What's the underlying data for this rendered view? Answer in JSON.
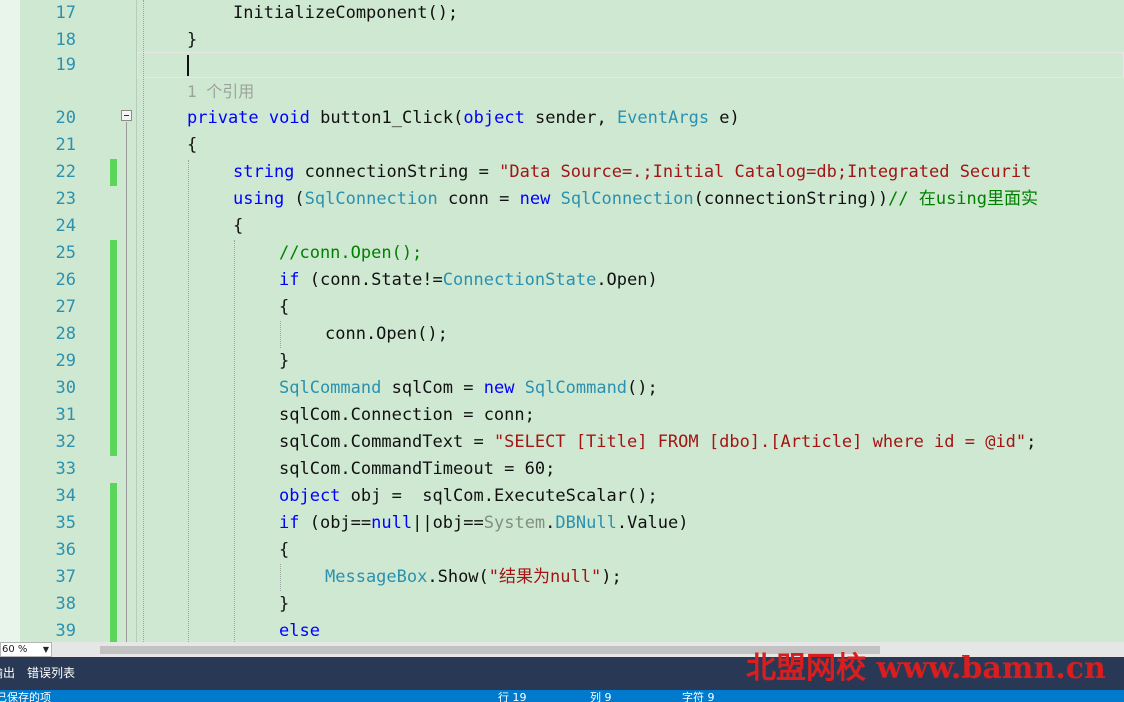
{
  "editor": {
    "codelens": "1 个引用",
    "lines": [
      {
        "num": "17",
        "indent": 1,
        "tokens": [
          {
            "t": "InitializeComponent();",
            "c": ""
          }
        ]
      },
      {
        "num": "18",
        "indent": 0,
        "tokens": [
          {
            "t": "}",
            "c": ""
          }
        ]
      },
      {
        "num": "19",
        "indent": 0,
        "tokens": []
      },
      {
        "num": "20",
        "indent": 0,
        "tokens": [
          {
            "t": "private",
            "c": "kw"
          },
          {
            "t": " ",
            "c": ""
          },
          {
            "t": "void",
            "c": "kw"
          },
          {
            "t": " button1_Click(",
            "c": ""
          },
          {
            "t": "object",
            "c": "kw"
          },
          {
            "t": " sender, ",
            "c": ""
          },
          {
            "t": "EventArgs",
            "c": "ty"
          },
          {
            "t": " e)",
            "c": ""
          }
        ]
      },
      {
        "num": "21",
        "indent": 0,
        "tokens": [
          {
            "t": "{",
            "c": ""
          }
        ]
      },
      {
        "num": "22",
        "indent": 1,
        "changed": true,
        "tokens": [
          {
            "t": "string",
            "c": "kw"
          },
          {
            "t": " connectionString = ",
            "c": ""
          },
          {
            "t": "\"Data Source=.;Initial Catalog=db;Integrated Securit",
            "c": "str"
          }
        ]
      },
      {
        "num": "23",
        "indent": 1,
        "tokens": [
          {
            "t": "using",
            "c": "kw"
          },
          {
            "t": " (",
            "c": ""
          },
          {
            "t": "SqlConnection",
            "c": "ty"
          },
          {
            "t": " conn = ",
            "c": ""
          },
          {
            "t": "new",
            "c": "kw"
          },
          {
            "t": " ",
            "c": ""
          },
          {
            "t": "SqlConnection",
            "c": "ty"
          },
          {
            "t": "(connectionString))",
            "c": ""
          },
          {
            "t": "// 在using里面实",
            "c": "cm"
          }
        ]
      },
      {
        "num": "24",
        "indent": 1,
        "tokens": [
          {
            "t": "{",
            "c": ""
          }
        ]
      },
      {
        "num": "25",
        "indent": 2,
        "changed": true,
        "tokens": [
          {
            "t": "//conn.Open();",
            "c": "cm"
          }
        ]
      },
      {
        "num": "26",
        "indent": 2,
        "changed": true,
        "tokens": [
          {
            "t": "if",
            "c": "kw"
          },
          {
            "t": " (conn.State!=",
            "c": ""
          },
          {
            "t": "ConnectionState",
            "c": "ty"
          },
          {
            "t": ".Open)",
            "c": ""
          }
        ]
      },
      {
        "num": "27",
        "indent": 2,
        "changed": true,
        "tokens": [
          {
            "t": "{",
            "c": ""
          }
        ]
      },
      {
        "num": "28",
        "indent": 3,
        "changed": true,
        "tokens": [
          {
            "t": "conn.Open();",
            "c": ""
          }
        ]
      },
      {
        "num": "29",
        "indent": 2,
        "changed": true,
        "tokens": [
          {
            "t": "}",
            "c": ""
          }
        ]
      },
      {
        "num": "30",
        "indent": 2,
        "changed": true,
        "tokens": [
          {
            "t": "SqlCommand",
            "c": "ty"
          },
          {
            "t": " sqlCom = ",
            "c": ""
          },
          {
            "t": "new",
            "c": "kw"
          },
          {
            "t": " ",
            "c": ""
          },
          {
            "t": "SqlCommand",
            "c": "ty"
          },
          {
            "t": "();",
            "c": ""
          }
        ]
      },
      {
        "num": "31",
        "indent": 2,
        "changed": true,
        "tokens": [
          {
            "t": "sqlCom.Connection = conn;",
            "c": ""
          }
        ]
      },
      {
        "num": "32",
        "indent": 2,
        "changed": true,
        "tokens": [
          {
            "t": "sqlCom.CommandText = ",
            "c": ""
          },
          {
            "t": "\"SELECT [Title] FROM [dbo].[Article] where id = @id\"",
            "c": "str"
          },
          {
            "t": ";",
            "c": ""
          }
        ]
      },
      {
        "num": "33",
        "indent": 2,
        "tokens": [
          {
            "t": "sqlCom.CommandTimeout = 60;",
            "c": ""
          }
        ]
      },
      {
        "num": "34",
        "indent": 2,
        "changed": true,
        "tokens": [
          {
            "t": "object",
            "c": "kw"
          },
          {
            "t": " obj =  sqlCom.ExecuteScalar();",
            "c": ""
          }
        ]
      },
      {
        "num": "35",
        "indent": 2,
        "changed": true,
        "tokens": [
          {
            "t": "if",
            "c": "kw"
          },
          {
            "t": " (obj==",
            "c": ""
          },
          {
            "t": "null",
            "c": "kw"
          },
          {
            "t": "||obj==",
            "c": ""
          },
          {
            "t": "System",
            "c": "gr"
          },
          {
            "t": ".",
            "c": ""
          },
          {
            "t": "DBNull",
            "c": "ty"
          },
          {
            "t": ".Value)",
            "c": ""
          }
        ]
      },
      {
        "num": "36",
        "indent": 2,
        "changed": true,
        "tokens": [
          {
            "t": "{",
            "c": ""
          }
        ]
      },
      {
        "num": "37",
        "indent": 3,
        "changed": true,
        "tokens": [
          {
            "t": "MessageBox",
            "c": "ty"
          },
          {
            "t": ".Show(",
            "c": ""
          },
          {
            "t": "\"结果为null\"",
            "c": "str"
          },
          {
            "t": ");",
            "c": ""
          }
        ]
      },
      {
        "num": "38",
        "indent": 2,
        "changed": true,
        "tokens": [
          {
            "t": "}",
            "c": ""
          }
        ]
      },
      {
        "num": "39",
        "indent": 2,
        "changed": true,
        "tokens": [
          {
            "t": "else",
            "c": "kw"
          }
        ]
      }
    ]
  },
  "zoom": {
    "value": "60 %"
  },
  "bottom_tabs": [
    {
      "label": "输出"
    },
    {
      "label": "错误列表"
    }
  ],
  "watermark": "北盟网校 www.bamn.cn",
  "status_bar": {
    "left": "已保存的项",
    "line": "行 19",
    "col": "列 9",
    "ch": "字符 9"
  }
}
